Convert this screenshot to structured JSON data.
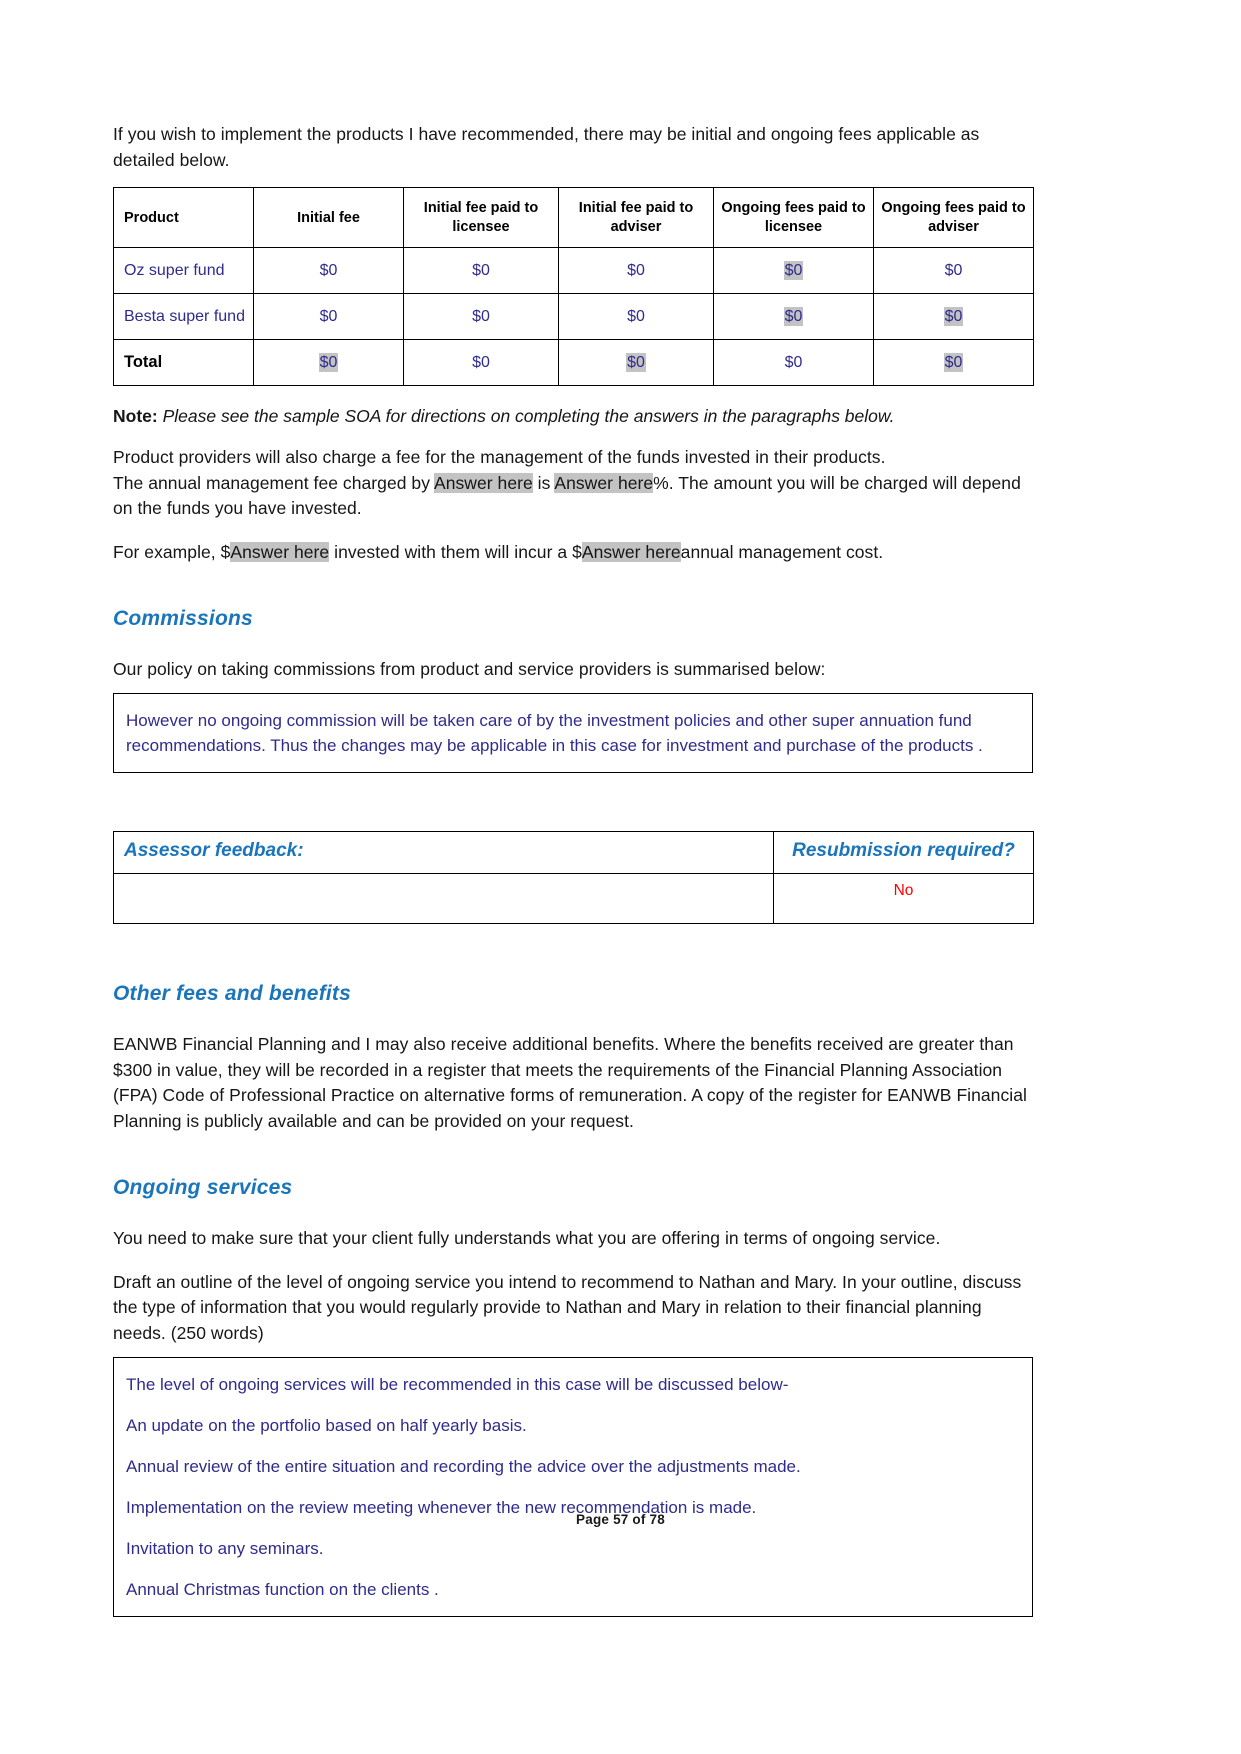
{
  "intro": {
    "paragraph": "If you wish to implement the products I have recommended, there may be initial and ongoing fees applicable as detailed below."
  },
  "fee_table": {
    "headers": [
      "Product",
      "Initial fee",
      "Initial fee paid to licensee",
      "Initial fee paid to adviser",
      "Ongoing fees paid to licensee",
      "Ongoing fees paid to adviser"
    ],
    "rows": [
      {
        "product": "Oz super fund",
        "initial_fee": "$0",
        "initial_fee_licensee": "$0",
        "initial_fee_adviser": "$0",
        "ongoing_fees_licensee": "$0",
        "ongoing_fees_adviser": "$0"
      },
      {
        "product": "Besta super fund",
        "initial_fee": "$0",
        "initial_fee_licensee": "$0",
        "initial_fee_adviser": "$0",
        "ongoing_fees_licensee": "$0",
        "ongoing_fees_adviser": "$0"
      },
      {
        "product": "Total",
        "initial_fee": "$0",
        "initial_fee_licensee": "$0",
        "initial_fee_adviser": "$0",
        "ongoing_fees_licensee": "$0",
        "ongoing_fees_adviser": "$0"
      }
    ]
  },
  "note": {
    "label": "Note:",
    "text": " Please see the sample SOA for directions on completing the answers in the paragraphs below",
    "trailing": "."
  },
  "management_fee": {
    "line1": "Product providers will also charge a fee for the management of the funds invested in their products.",
    "line2_part1": "The annual management fee charged by ",
    "answer1": "Answer here",
    "line2_part2": " is ",
    "answer2": "Answer here",
    "line2_part3": "%. The amount you will be charged will depend on the funds you have invested.",
    "example_part1": "For example, $",
    "example_answer1": "Answer here",
    "example_part2": " invested with them will incur a $",
    "example_answer2": "Answer here",
    "example_part3": "annual management cost."
  },
  "commissions": {
    "heading": "Commissions",
    "intro": "Our policy on taking commissions from product and service providers is summarised below:",
    "answer": "However no ongoing commission will be taken care of by the investment policies and other super annuation fund recommendations. Thus the changes may be applicable in this case for investment and purchase of the products ."
  },
  "assessor": {
    "feedback_label": "Assessor feedback:",
    "resubmission_label": "Resubmission required?",
    "feedback_value": "",
    "resubmission_value": "No"
  },
  "other_fees": {
    "heading": "Other fees and benefits",
    "paragraph": "EANWB Financial Planning and I may also receive additional benefits. Where the benefits received are greater than $300 in value, they will be recorded in a register that meets the requirements of the Financial Planning Association (FPA) Code of Professional Practice on alternative forms of remuneration. A copy of the register for EANWB Financial Planning is publicly available and can be provided on your request."
  },
  "ongoing_services": {
    "heading": "Ongoing services",
    "paragraph1": "You need to make sure that your client fully understands what you are offering in terms of ongoing service.",
    "paragraph2": "Draft an outline of the level of ongoing service you intend to recommend to Nathan and Mary. In your outline, discuss the type of information that you would regularly provide to Nathan and Mary in relation to their financial planning needs. (250 words)",
    "answer_lines": [
      "The level of ongoing services will be recommended in this case will be discussed below-",
      "An update on the portfolio based on half yearly basis.",
      "Annual review of the entire situation and recording the advice over the adjustments made.",
      "Implementation on the review meeting whenever the new recommendation is made.",
      " Invitation to any seminars.",
      " Annual Christmas function on the clients ."
    ]
  },
  "footer": {
    "page_label": "Page 57 of 78"
  },
  "colors": {
    "heading_blue": "#1b75bb",
    "answer_purple": "#2f2b8c",
    "highlight_gray": "#c3c3c3",
    "resubmission_red": "#ff0000"
  }
}
